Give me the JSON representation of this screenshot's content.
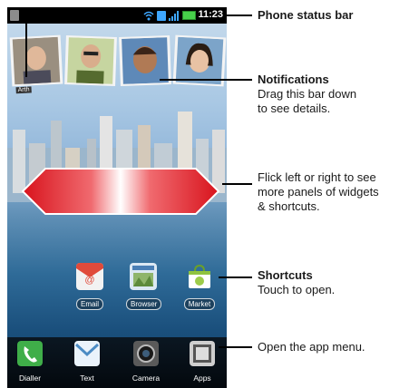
{
  "status_bar": {
    "time": "11:23"
  },
  "contacts_widget": {
    "first_contact_name": "Arth"
  },
  "shortcuts": [
    {
      "name": "email",
      "label": "Email"
    },
    {
      "name": "browser",
      "label": "Browser"
    },
    {
      "name": "market",
      "label": "Market"
    }
  ],
  "dock": [
    {
      "name": "dialler",
      "label": "Dialler"
    },
    {
      "name": "text",
      "label": "Text"
    },
    {
      "name": "camera",
      "label": "Camera"
    },
    {
      "name": "apps",
      "label": "Apps"
    }
  ],
  "callouts": {
    "status_bar": {
      "title": "Phone status bar"
    },
    "notifications": {
      "title": "Notifications",
      "desc_line1": "Drag this bar down",
      "desc_line2": "to see details."
    },
    "flick": {
      "line1": "Flick left or right to see",
      "line2": "more panels of widgets",
      "line3": "& shortcuts."
    },
    "shortcuts": {
      "title": "Shortcuts",
      "desc": "Touch to open."
    },
    "app_menu": {
      "text": "Open the app menu."
    }
  },
  "colors": {
    "arrow_red": "#e3242b",
    "battery": "#47d14a",
    "sync": "#3ea7ff"
  }
}
